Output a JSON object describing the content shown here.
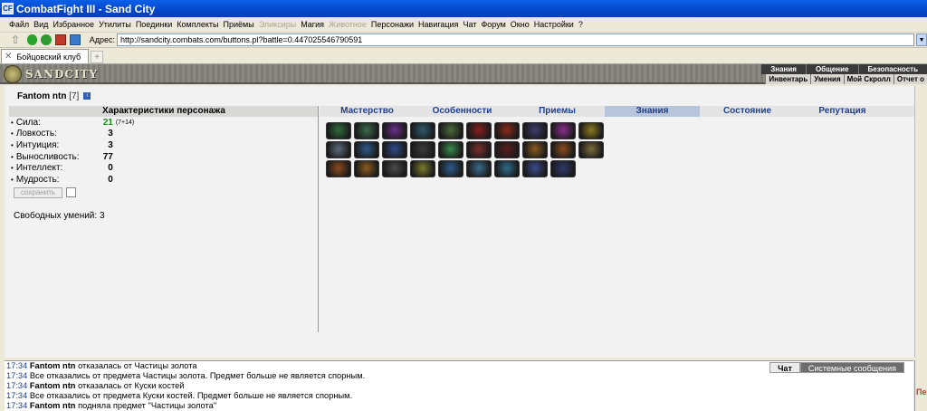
{
  "window": {
    "title": "CombatFight III - Sand City",
    "icon_label": "CF"
  },
  "menu": [
    {
      "label": "Файл",
      "enabled": true
    },
    {
      "label": "Вид",
      "enabled": true
    },
    {
      "label": "Избранное",
      "enabled": true
    },
    {
      "label": "Утилиты",
      "enabled": true
    },
    {
      "label": "Поединки",
      "enabled": true
    },
    {
      "label": "Комплекты",
      "enabled": true
    },
    {
      "label": "Приёмы",
      "enabled": true
    },
    {
      "label": "Эликсиры",
      "enabled": false
    },
    {
      "label": "Магия",
      "enabled": true
    },
    {
      "label": "Животное",
      "enabled": false
    },
    {
      "label": "Персонажи",
      "enabled": true
    },
    {
      "label": "Навигация",
      "enabled": true
    },
    {
      "label": "Чат",
      "enabled": true
    },
    {
      "label": "Форум",
      "enabled": true
    },
    {
      "label": "Окно",
      "enabled": true
    },
    {
      "label": "Настройки",
      "enabled": true
    },
    {
      "label": "?",
      "enabled": true
    }
  ],
  "address": {
    "label": "Адрес:",
    "url": "http://sandcity.combats.com/buttons.pl?battle=0.447025546790591"
  },
  "browser_tab": {
    "label": "Бойцовский клуб",
    "add": "+"
  },
  "game": {
    "logo": "SANDCITY",
    "nav_top": [
      "Знания",
      "Общение",
      "Безопасность"
    ],
    "nav_bottom": [
      "Инвентарь",
      "Умения",
      "Мой Скролл",
      "Отчет о"
    ]
  },
  "character": {
    "name": "Fantom ntn",
    "level": "[7]",
    "info": "i"
  },
  "stats": {
    "header": "Характеристики персонажа",
    "rows": [
      {
        "name": "Сила:",
        "value": "21",
        "extra": "(7+14)",
        "highlight": true
      },
      {
        "name": "Ловкость:",
        "value": "3",
        "extra": "",
        "highlight": false
      },
      {
        "name": "Интуиция:",
        "value": "3",
        "extra": "",
        "highlight": false
      },
      {
        "name": "Выносливость:",
        "value": "77",
        "extra": "",
        "highlight": false
      },
      {
        "name": "Интеллект:",
        "value": "0",
        "extra": "",
        "highlight": false
      },
      {
        "name": "Мудрость:",
        "value": "0",
        "extra": "",
        "highlight": false
      }
    ],
    "save_label": "сохранить",
    "free_skills": "Свободных умений: 3"
  },
  "skill_tabs": [
    "Мастерство",
    "Особенности",
    "Приемы",
    "Знания",
    "Состояние",
    "Репутация"
  ],
  "active_skill_tab": "Знания",
  "icon_colors": [
    [
      "#2e6b3a",
      "#3b6b4b",
      "#6b2e8b",
      "#2e5b6b",
      "#4b6b3a",
      "#8b1e1e",
      "#8b2a1a",
      "#3b3b6b",
      "#8b2e8b",
      "#8b7b1e"
    ],
    [
      "#5b6b7b",
      "#2e5b8b",
      "#2e4b8b",
      "#3b3b3b",
      "#3b8b4b",
      "#7b2e2e",
      "#5b1e1e",
      "#8b5b1e",
      "#8b4b1e",
      "#7b6b3b"
    ],
    [
      "#8b4b1e",
      "#8b5b1e",
      "#4b4b4b",
      "#7b7b2e",
      "#2e5b8b",
      "#3b6b8b",
      "#2e6b8b",
      "#3b4b8b",
      "#2e3b6b"
    ]
  ],
  "chat": {
    "tabs": [
      "Чат",
      "Системные сообщения"
    ],
    "lines": [
      {
        "time": "17:34",
        "user": "Fantom ntn",
        "text": "отказалась от Частицы золота"
      },
      {
        "time": "17:34",
        "user": "",
        "text": "Все отказались от предмета Частицы золота. Предмет больше не является спорным."
      },
      {
        "time": "17:34",
        "user": "Fantom ntn",
        "text": "отказалась от Куски костей"
      },
      {
        "time": "17:34",
        "user": "",
        "text": "Все отказались от предмета Куски костей. Предмет больше не является спорным."
      },
      {
        "time": "17:34",
        "user": "Fantom ntn",
        "text": "подняла предмет \"Частицы золота\""
      }
    ]
  },
  "side_label": "Пе"
}
